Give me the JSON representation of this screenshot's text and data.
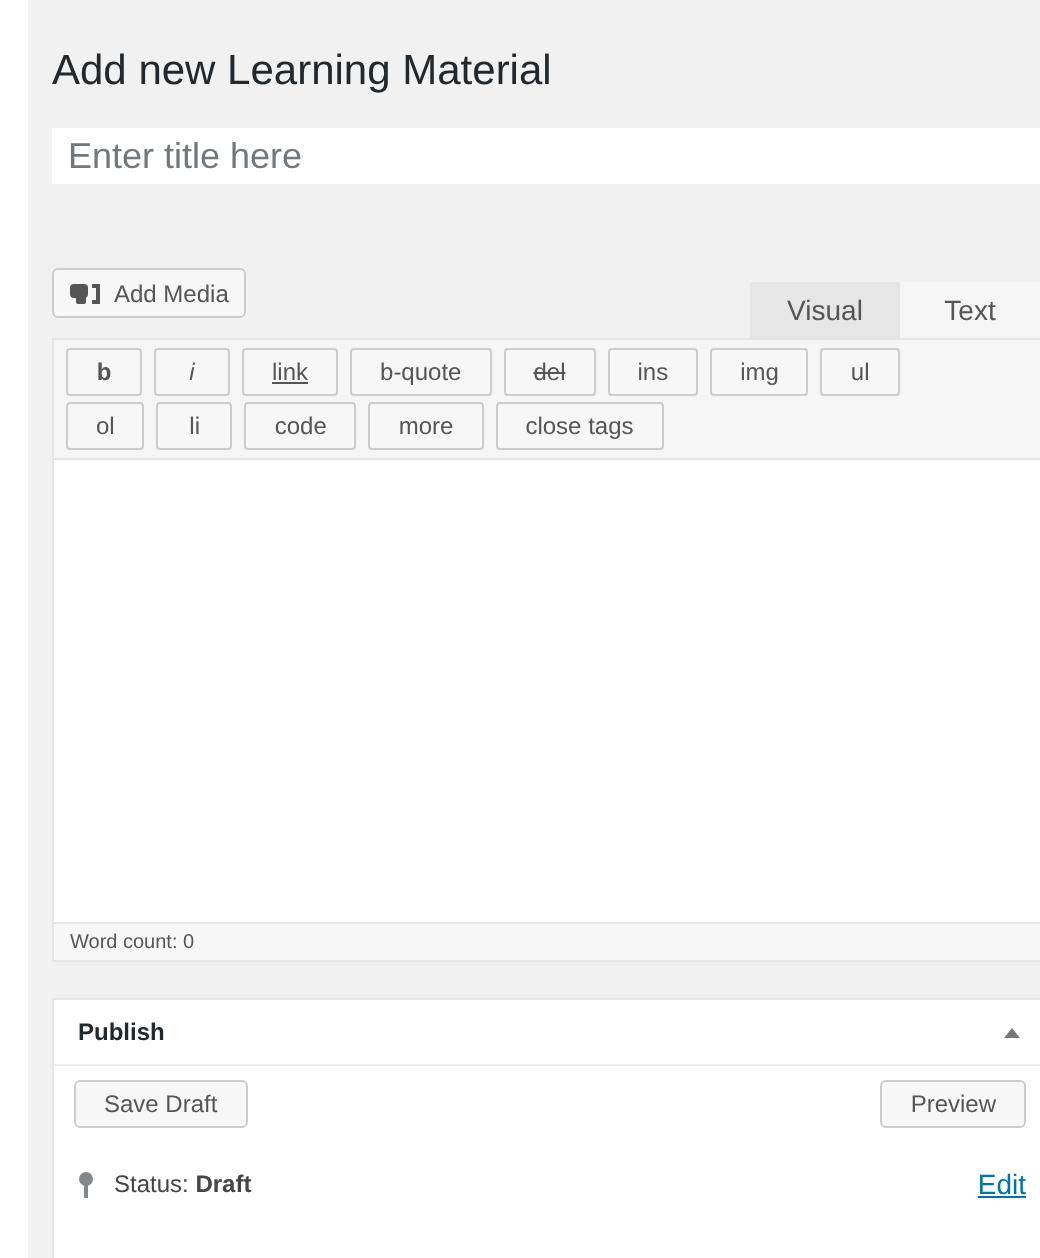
{
  "heading": "Add new Learning Material",
  "title_field": {
    "placeholder": "Enter title here"
  },
  "add_media": "Add Media",
  "tabs": [
    {
      "label": "Visual",
      "selected": false
    },
    {
      "label": "Text",
      "selected": true
    }
  ],
  "quicktags": [
    [
      {
        "label": "b",
        "kind": "bold"
      },
      {
        "label": "i",
        "kind": "italic"
      },
      {
        "label": "link",
        "kind": "link"
      },
      {
        "label": "b-quote",
        "kind": "plain"
      },
      {
        "label": "del",
        "kind": "strike"
      },
      {
        "label": "ins",
        "kind": "plain"
      },
      {
        "label": "img",
        "kind": "plain"
      },
      {
        "label": "ul",
        "kind": "plain"
      }
    ],
    [
      {
        "label": "ol",
        "kind": "plain"
      },
      {
        "label": "li",
        "kind": "plain"
      },
      {
        "label": "code",
        "kind": "plain"
      },
      {
        "label": "more",
        "kind": "plain"
      },
      {
        "label": "close tags",
        "kind": "plain"
      }
    ]
  ],
  "word_count": "Word count: 0",
  "publish": {
    "title": "Publish",
    "expanded": true,
    "save_draft": "Save Draft",
    "preview": "Preview",
    "status": "Status: **Draft**",
    "status_edit": "Edit"
  }
}
